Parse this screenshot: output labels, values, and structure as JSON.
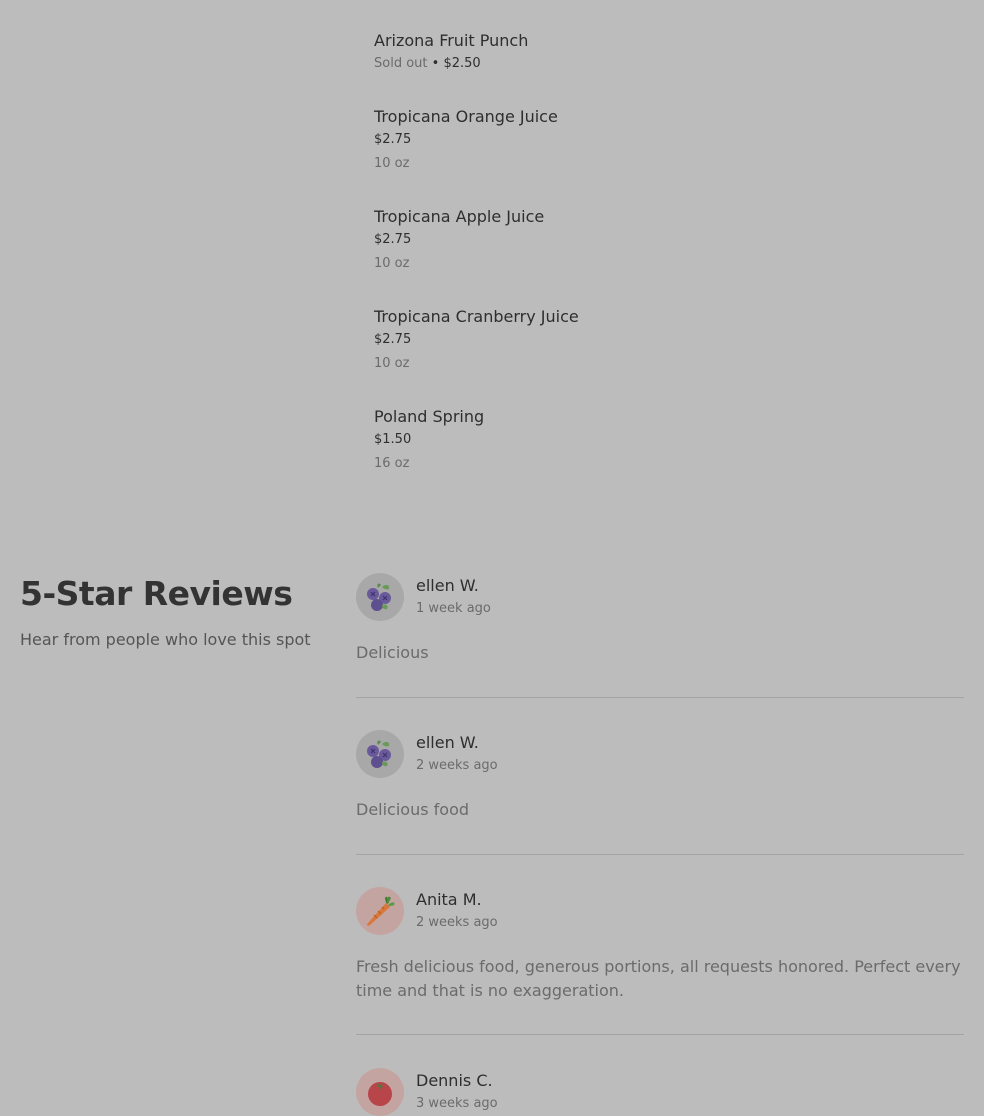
{
  "menu": {
    "items": [
      {
        "name": "Arizona Fruit Punch",
        "status": "Sold out",
        "separator": "•",
        "price": "$2.50",
        "size": ""
      },
      {
        "name": "Tropicana Orange Juice",
        "price": "$2.75",
        "size": "10 oz"
      },
      {
        "name": "Tropicana Apple Juice",
        "price": "$2.75",
        "size": "10 oz"
      },
      {
        "name": "Tropicana Cranberry Juice",
        "price": "$2.75",
        "size": "10 oz"
      },
      {
        "name": "Poland Spring",
        "price": "$1.50",
        "size": "16 oz"
      }
    ]
  },
  "reviews_section": {
    "title": "5-Star Reviews",
    "subtitle": "Hear from people who love this spot",
    "reviews": [
      {
        "name": "ellen W.",
        "date": "1 week ago",
        "text": "Delicious",
        "avatar_icon": "blueberry-icon",
        "avatar_color": "#a8a8a8"
      },
      {
        "name": "ellen W.",
        "date": "2 weeks ago",
        "text": "Delicious food",
        "avatar_icon": "blueberry-icon",
        "avatar_color": "#a8a8a8"
      },
      {
        "name": "Anita M.",
        "date": "2 weeks ago",
        "text": "Fresh delicious food, generous portions, all requests honored. Perfect every time and that is no exaggeration.",
        "avatar_icon": "carrot-icon",
        "avatar_color": "#c4a4a0"
      },
      {
        "name": "Dennis C.",
        "date": "3 weeks ago",
        "text": "",
        "avatar_icon": "tomato-icon",
        "avatar_color": "#c4a4a0"
      }
    ]
  },
  "colors": {
    "background": "#bcbcbc",
    "text_primary": "#2e2e2e",
    "text_secondary": "#6b6b6b",
    "divider": "#a4a4a4"
  }
}
